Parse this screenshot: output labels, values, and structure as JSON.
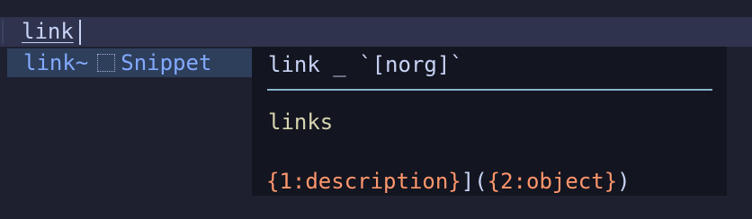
{
  "editor": {
    "line_text": "link"
  },
  "completion_menu": {
    "items": [
      {
        "word": "link~",
        "kind_icon": "snippet-icon",
        "kind": "Snippet"
      }
    ]
  },
  "documentation": {
    "title": "link _ `[norg]`",
    "description": "links",
    "snippet_body": {
      "part1": "{1:description}",
      "part2": "](",
      "part3": "{2:object}",
      "part4": ")"
    }
  }
}
